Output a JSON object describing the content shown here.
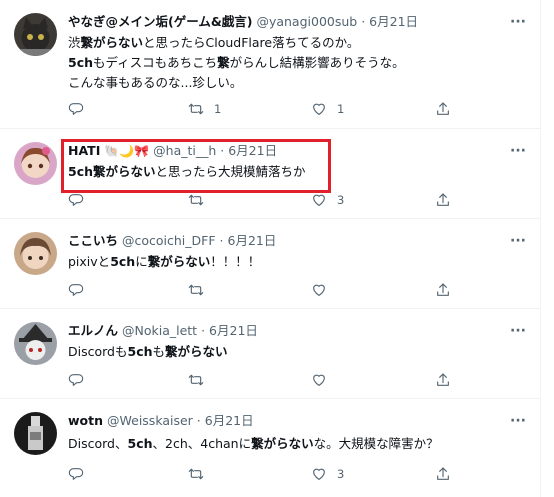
{
  "tweets": [
    {
      "name": "やなぎ@メイン垢(ゲーム&戯言)",
      "handle": "@yanagi000sub",
      "sep": "·",
      "date": "6月21日",
      "line1": [
        {
          "t": "渋",
          "b": false
        },
        {
          "t": "繋がらない",
          "b": true
        },
        {
          "t": "と思ったらCloudFlare落ちてるのか。",
          "b": false
        }
      ],
      "line2": [
        {
          "t": "5ch",
          "b": true
        },
        {
          "t": "もディスコもあちこち",
          "b": false
        },
        {
          "t": "繋",
          "b": true
        },
        {
          "t": "がらんし結構影響ありそうな。",
          "b": false
        }
      ],
      "line3": [
        {
          "t": "こんな事もあるのな...珍しい。",
          "b": false
        }
      ],
      "retweets": "1",
      "likes": "1"
    },
    {
      "name": "HATI",
      "emoji": "🐚🌙🎀",
      "handle": "@ha_ti__h",
      "sep": "·",
      "date": "6月21日",
      "line1": [
        {
          "t": "5ch繋がらない",
          "b": true
        },
        {
          "t": "と思ったら大規模鯖落ちか",
          "b": false
        }
      ],
      "likes": "3"
    },
    {
      "name": "ここいち",
      "handle": "@cocoichi_DFF",
      "sep": "·",
      "date": "6月21日",
      "line1": [
        {
          "t": "pixivと",
          "b": false
        },
        {
          "t": "5ch",
          "b": true
        },
        {
          "t": "に",
          "b": false
        },
        {
          "t": "繋がらない",
          "b": true
        },
        {
          "t": "！！！！",
          "b": false
        }
      ]
    },
    {
      "name": "エルノん",
      "handle": "@Nokia_lett",
      "sep": "·",
      "date": "6月21日",
      "line1": [
        {
          "t": "Discordも",
          "b": false
        },
        {
          "t": "5ch",
          "b": true
        },
        {
          "t": "も",
          "b": false
        },
        {
          "t": "繋がらない",
          "b": true
        }
      ]
    },
    {
      "name": "wotn",
      "handle": "@Weisskaiser",
      "sep": "·",
      "date": "6月21日",
      "line1": [
        {
          "t": "Discord、",
          "b": false
        },
        {
          "t": "5ch",
          "b": true
        },
        {
          "t": "、2ch、4chanに",
          "b": false
        },
        {
          "t": "繋がらない",
          "b": true
        },
        {
          "t": "な。大規模な障害か？",
          "b": false
        }
      ],
      "likes": "3"
    }
  ],
  "icons": {
    "more": "more-horizontal-icon",
    "reply": "reply-icon",
    "retweet": "retweet-icon",
    "like": "heart-icon",
    "share": "share-icon"
  },
  "colors": {
    "text": "#0f1419",
    "muted": "#536471",
    "highlight_border": "#e0202a",
    "divider": "#eff3f4"
  }
}
